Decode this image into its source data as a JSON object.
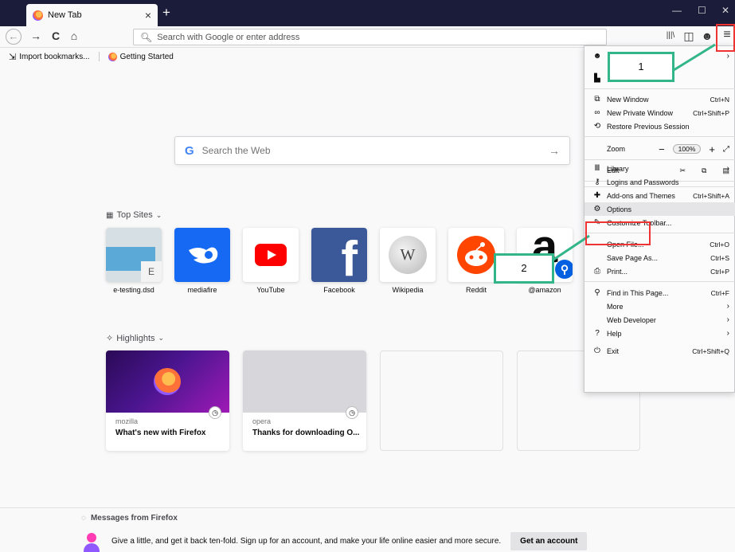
{
  "tab": {
    "title": "New Tab",
    "close": "×"
  },
  "tabstrip": {
    "new_tab": "+",
    "minimize": "—",
    "maximize": "☐",
    "close": "✕"
  },
  "navbar": {
    "back": "←",
    "forward": "→",
    "reload": "C",
    "home": "⌂",
    "url_placeholder": "Search with Google or enter address",
    "library": "|||\\",
    "sidebar": "◫",
    "account": "☻",
    "menu": "≡"
  },
  "bookmarks": [
    {
      "label": "Import bookmarks..."
    },
    {
      "label": "Getting Started"
    }
  ],
  "search": {
    "logo": "G",
    "placeholder": "Search the Web",
    "arrow": "→"
  },
  "top_sites": {
    "title": "Top Sites",
    "tiles": [
      {
        "label": "e-testing.dsd",
        "badge": "E"
      },
      {
        "label": "mediafire"
      },
      {
        "label": "YouTube"
      },
      {
        "label": "Facebook",
        "glyph": "f"
      },
      {
        "label": "Wikipedia",
        "glyph": "W"
      },
      {
        "label": "Reddit"
      },
      {
        "label": "@amazon",
        "glyph": "a"
      }
    ]
  },
  "highlights": {
    "title": "Highlights",
    "cards": [
      {
        "source": "mozilla",
        "title": "What's new with Firefox"
      },
      {
        "source": "opera",
        "title": "Thanks for downloading O..."
      }
    ]
  },
  "messages": {
    "title": "Messages from Firefox",
    "text": "Give a little, and get it back ten-fold. Sign up for an account, and make your life online easier and more secure.",
    "button": "Get an account"
  },
  "menu": {
    "items": [
      {
        "label": "New Window",
        "shortcut": "Ctrl+N"
      },
      {
        "label": "New Private Window",
        "shortcut": "Ctrl+Shift+P"
      },
      {
        "label": "Restore Previous Session",
        "shortcut": ""
      },
      {
        "label": "Zoom",
        "zoom": "100%"
      },
      {
        "label": "Edit"
      },
      {
        "label": "Library"
      },
      {
        "label": "Logins and Passwords"
      },
      {
        "label": "Add-ons and Themes",
        "shortcut": "Ctrl+Shift+A"
      },
      {
        "label": "Options"
      },
      {
        "label": "Customize Toolbar..."
      },
      {
        "label": "Open File...",
        "shortcut": "Ctrl+O"
      },
      {
        "label": "Save Page As...",
        "shortcut": "Ctrl+S"
      },
      {
        "label": "Print...",
        "shortcut": "Ctrl+P"
      },
      {
        "label": "Find in This Page...",
        "shortcut": "Ctrl+F"
      },
      {
        "label": "More"
      },
      {
        "label": "Web Developer"
      },
      {
        "label": "Help"
      },
      {
        "label": "Exit",
        "shortcut": "Ctrl+Shift+Q"
      }
    ]
  },
  "annotations": {
    "step1": "1",
    "step2": "2",
    "color": "#33b58a",
    "highlight_color": "#ee3333"
  }
}
